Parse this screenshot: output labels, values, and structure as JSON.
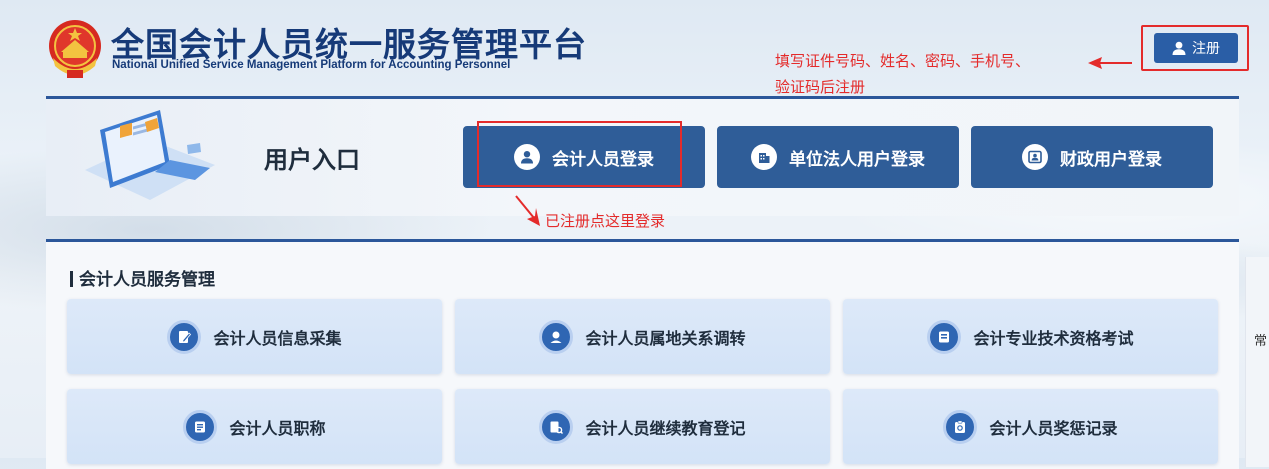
{
  "header": {
    "title": "全国会计人员统一服务管理平台",
    "subtitle": "National Unified Service Management Platform for Accounting Personnel",
    "register_label": "注册"
  },
  "annotations": {
    "register_note_line1": "填写证件号码、姓名、密码、手机号、",
    "register_note_line2": "验证码后注册",
    "login_note": "已注册点这里登录"
  },
  "entry": {
    "title": "用户入口",
    "buttons": [
      {
        "label": "会计人员登录",
        "icon": "user-icon"
      },
      {
        "label": "单位法人用户登录",
        "icon": "building-icon"
      },
      {
        "label": "财政用户登录",
        "icon": "id-card-icon"
      }
    ]
  },
  "services": {
    "title": "会计人员服务管理",
    "items": [
      {
        "label": "会计人员信息采集",
        "icon": "edit-document-icon"
      },
      {
        "label": "会计人员属地关系调转",
        "icon": "location-icon"
      },
      {
        "label": "会计专业技术资格考试",
        "icon": "exam-icon"
      },
      {
        "label": "会计人员职称",
        "icon": "title-list-icon"
      },
      {
        "label": "会计人员继续教育登记",
        "icon": "education-search-icon"
      },
      {
        "label": "会计人员奖惩记录",
        "icon": "record-clipboard-icon"
      }
    ]
  },
  "side": {
    "char_1": "常"
  },
  "colors": {
    "brand_blue": "#2f5d98",
    "title_blue": "#163a78",
    "annotation_red": "#e42b2b",
    "card_bg": "#d8e6f8"
  }
}
